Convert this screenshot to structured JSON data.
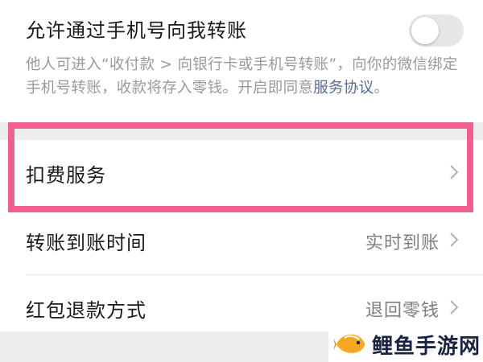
{
  "transfer_setting": {
    "label": "允许通过手机号向我转账",
    "enabled": false,
    "description": "他人可进入“收付款 > 向银行卡或手机号转账”，向你的微信绑定手机号转账，收款将存入零钱。开启即同意",
    "agreement_link": "服务协议",
    "period": "。"
  },
  "settings_list": [
    {
      "label": "扣费服务",
      "value": ""
    },
    {
      "label": "转账到账时间",
      "value": "实时到账"
    },
    {
      "label": "红包退款方式",
      "value": "退回零钱"
    }
  ],
  "highlight_color": "#ef5f8f",
  "link_color": "#576b95",
  "watermark": {
    "text": "鲤鱼手游网",
    "icon": "fish-logo-icon"
  }
}
